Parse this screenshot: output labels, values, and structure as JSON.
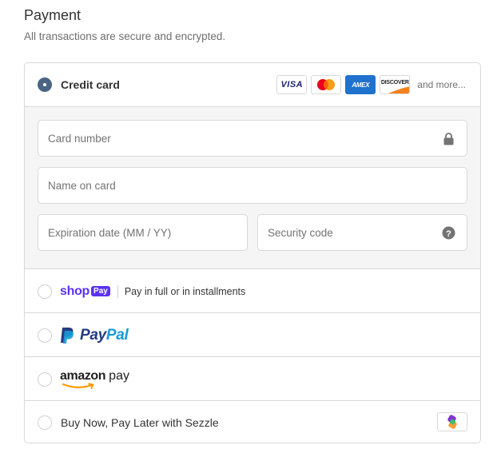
{
  "header": {
    "title": "Payment",
    "subtitle": "All transactions are secure and encrypted."
  },
  "credit_card": {
    "label": "Credit card",
    "selected": true,
    "card_brands": [
      "VISA",
      "Mastercard",
      "AMEX",
      "DISCOVER"
    ],
    "visa_text": "VISA",
    "amex_text": "AMEX",
    "discover_text": "DISCOVER",
    "more_text": "and more...",
    "fields": {
      "card_number_placeholder": "Card number",
      "name_placeholder": "Name on card",
      "expiration_placeholder": "Expiration date (MM / YY)",
      "security_placeholder": "Security code"
    }
  },
  "shop_pay": {
    "brand_word": "shop",
    "brand_badge": "Pay",
    "description": "Pay in full or in installments",
    "selected": false
  },
  "paypal": {
    "word_dark": "Pay",
    "word_light": "Pal",
    "selected": false
  },
  "amazon_pay": {
    "word": "amazon",
    "pay": "pay",
    "selected": false
  },
  "sezzle": {
    "label": "Buy Now, Pay Later with Sezzle",
    "selected": false
  },
  "colors": {
    "selected_radio": "#4a6584",
    "shop_purple": "#5a31f4",
    "paypal_dark": "#253b80",
    "paypal_light": "#179bd7",
    "amex_blue": "#1f72cd",
    "form_background": "#f5f5f5"
  }
}
